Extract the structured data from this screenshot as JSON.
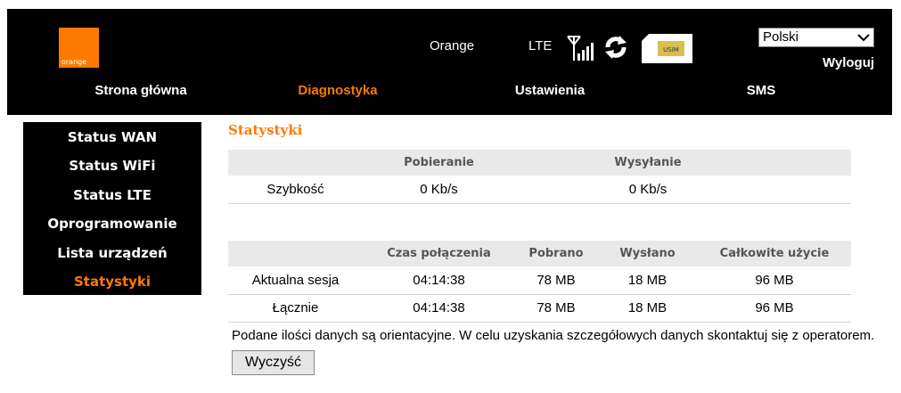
{
  "header": {
    "logo_text": "orange",
    "operator": "Orange",
    "network_type": "LTE",
    "sim_label": "USIM",
    "language": "Polski",
    "logout": "Wyloguj",
    "icons": [
      "signal-icon",
      "refresh-icon",
      "sim-card-icon",
      "chevron-down-icon"
    ],
    "accent_color": "#ff7900"
  },
  "nav": {
    "items": [
      {
        "label": "Strona główna",
        "active": false
      },
      {
        "label": "Diagnostyka",
        "active": true
      },
      {
        "label": "Ustawienia",
        "active": false
      },
      {
        "label": "SMS",
        "active": false
      }
    ]
  },
  "sidebar": {
    "items": [
      {
        "label": "Status WAN",
        "active": false
      },
      {
        "label": "Status WiFi",
        "active": false
      },
      {
        "label": "Status LTE",
        "active": false
      },
      {
        "label": "Oprogramowanie",
        "active": false
      },
      {
        "label": "Lista urządzeń",
        "active": false
      },
      {
        "label": "Statystyki",
        "active": true
      }
    ]
  },
  "main": {
    "title": "Statystyki",
    "speed_table": {
      "headers": [
        "",
        "Pobieranie",
        "Wysyłanie"
      ],
      "rows": [
        [
          "Szybkość",
          "0 Kb/s",
          "0 Kb/s"
        ]
      ]
    },
    "usage_table": {
      "headers": [
        "",
        "Czas połączenia",
        "Pobrano",
        "Wysłano",
        "Całkowite użycie"
      ],
      "rows": [
        [
          "Aktualna sesja",
          "04:14:38",
          "78 MB",
          "18 MB",
          "96 MB"
        ],
        [
          "Łącznie",
          "04:14:38",
          "78 MB",
          "18 MB",
          "96 MB"
        ]
      ]
    },
    "note": "Podane ilości danych są orientacyjne. W celu uzyskania szczegółowych danych skontaktuj się z operatorem.",
    "clear_button": "Wyczyść"
  }
}
